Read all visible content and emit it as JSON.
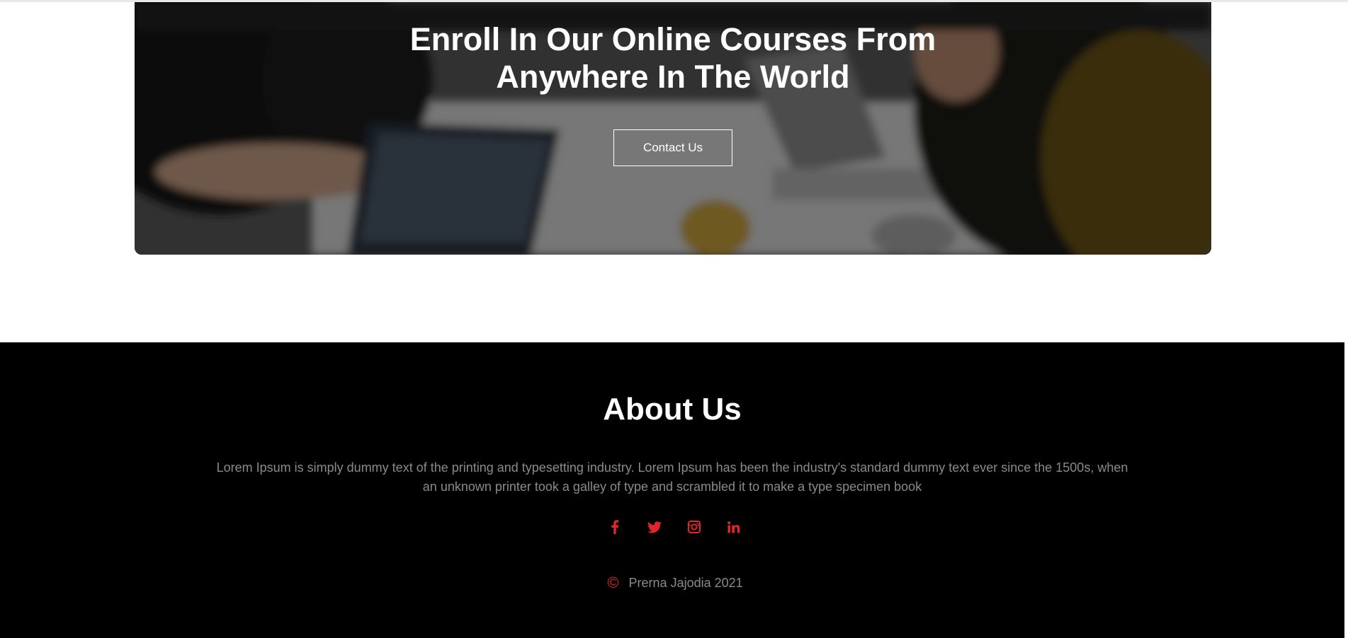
{
  "hero": {
    "title_line1": "Enroll In Our Online Courses From",
    "title_line2": "Anywhere In The World",
    "button_label": "Contact Us"
  },
  "about": {
    "title": "About Us",
    "text": "Lorem Ipsum is simply dummy text of the printing and typesetting industry. Lorem Ipsum has been the industry's standard dummy text ever since the 1500s, when an unknown printer took a galley of type and scrambled it to make a type specimen book"
  },
  "social": {
    "icons": [
      "facebook-icon",
      "twitter-icon",
      "instagram-icon",
      "linkedin-icon"
    ],
    "color": "#e0262a"
  },
  "copyright": {
    "symbol": "©",
    "text": "Prerna Jajodia 2021"
  },
  "colors": {
    "footer_bg": "#000000",
    "accent": "#e0262a",
    "muted_text": "#8a8a8a"
  }
}
